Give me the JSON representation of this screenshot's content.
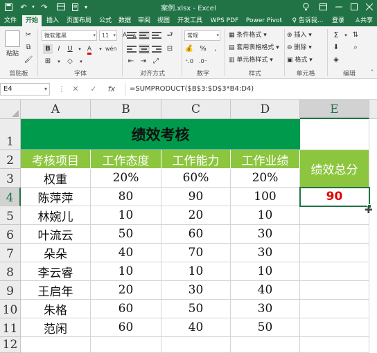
{
  "window": {
    "title": "案例.xlsx - Excel",
    "qat_icons": [
      "save-icon",
      "undo-icon",
      "redo-icon",
      "form-icon",
      "print-preview-icon",
      "customize-icon"
    ],
    "lightbulb_icon": "lightbulb-icon",
    "restore_icon": "ribbon-display-icon",
    "controls": [
      "minimize-icon",
      "maximize-icon",
      "close-icon"
    ]
  },
  "ribbon_tabs": [
    {
      "label": "文件",
      "active": false
    },
    {
      "label": "开始",
      "active": true
    },
    {
      "label": "插入",
      "active": false
    },
    {
      "label": "页面布局",
      "active": false
    },
    {
      "label": "公式",
      "active": false
    },
    {
      "label": "数据",
      "active": false
    },
    {
      "label": "审阅",
      "active": false
    },
    {
      "label": "视图",
      "active": false
    },
    {
      "label": "开发工具",
      "active": false
    },
    {
      "label": "WPS PDF",
      "active": false
    },
    {
      "label": "Power Pivot",
      "active": false
    },
    {
      "label": "♀ 告诉我...",
      "active": false
    },
    {
      "label": "登录",
      "active": false
    },
    {
      "label": "共享",
      "active": false
    }
  ],
  "ribbon": {
    "clipboard": {
      "label": "剪贴板",
      "paste_label": "粘贴"
    },
    "font": {
      "label": "字体",
      "font_name": "微软雅黑",
      "font_size": "11",
      "bold": "B",
      "italic": "I",
      "underline": "U",
      "font_color_glyph": "A",
      "grow": "A",
      "shrink": "A",
      "wen": "wén"
    },
    "alignment": {
      "label": "对齐方式"
    },
    "number": {
      "label": "数字",
      "format": "常规",
      "percent": "%",
      "comma": ","
    },
    "styles": {
      "label": "样式",
      "conditional": "条件格式",
      "table": "套用表格格式",
      "cell_styles": "单元格样式"
    },
    "cells": {
      "label": "单元格",
      "insert": "插入",
      "delete": "删除",
      "format": "格式"
    },
    "editing": {
      "label": "编辑",
      "sum": "Σ"
    }
  },
  "formula_bar": {
    "name_box": "E4",
    "cancel": "✕",
    "enter": "✓",
    "fx": "fx",
    "formula": "=SUMPRODUCT($B$3:$D$3*B4:D4)"
  },
  "sheet": {
    "columns": [
      "A",
      "B",
      "C",
      "D",
      "E"
    ],
    "rows": [
      "1",
      "2",
      "3",
      "4",
      "5",
      "6",
      "7",
      "8",
      "9",
      "10",
      "11",
      "12"
    ],
    "selected_cell": "E4",
    "title": "绩效考核",
    "headers": [
      "考核项目",
      "工作态度",
      "工作能力",
      "工作业绩"
    ],
    "total_header": "绩效总分",
    "weights": {
      "label": "权重",
      "values": [
        "20%",
        "60%",
        "20%"
      ]
    },
    "people": [
      {
        "name": "陈萍萍",
        "values": [
          "80",
          "90",
          "100"
        ],
        "total": "90"
      },
      {
        "name": "林婉儿",
        "values": [
          "10",
          "20",
          "10"
        ],
        "total": ""
      },
      {
        "name": "叶流云",
        "values": [
          "50",
          "60",
          "30"
        ],
        "total": ""
      },
      {
        "name": "朵朵",
        "values": [
          "40",
          "70",
          "30"
        ],
        "total": ""
      },
      {
        "name": "李云睿",
        "values": [
          "10",
          "10",
          "10"
        ],
        "total": ""
      },
      {
        "name": "王启年",
        "values": [
          "20",
          "30",
          "40"
        ],
        "total": ""
      },
      {
        "name": "朱格",
        "values": [
          "60",
          "50",
          "30"
        ],
        "total": ""
      },
      {
        "name": "范闲",
        "values": [
          "60",
          "40",
          "50"
        ],
        "total": ""
      }
    ]
  },
  "colors": {
    "excel_green": "#217346",
    "title_fill": "#009a4c",
    "header_fill": "#8cc63f",
    "total_text": "#e00000"
  }
}
